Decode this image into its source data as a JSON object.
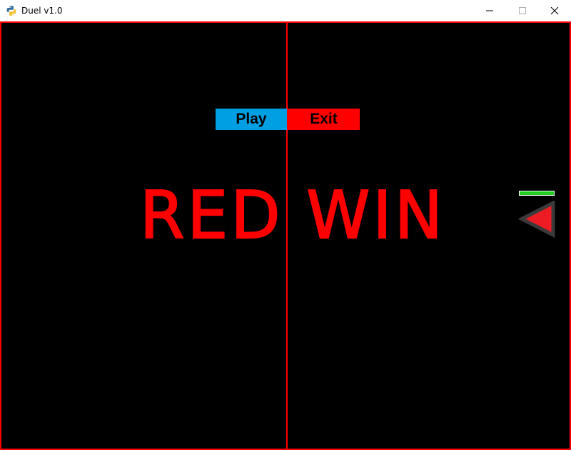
{
  "window": {
    "title": "Duel v1.0",
    "icon": "python-icon",
    "controls": [
      "minimize-icon",
      "maximize-icon",
      "close-icon"
    ]
  },
  "game": {
    "background_color": "#000000",
    "border_color": "#ff0000",
    "divider_color": "#ff0000",
    "menu": {
      "play_label": "Play",
      "play_color": "#009ee3",
      "exit_label": "Exit",
      "exit_color": "#ff0000"
    },
    "result_text": "RED WIN",
    "result_color": "#ff0000",
    "red_player": {
      "icon": "red-triangle-ship",
      "fill_color": "#ed1c24",
      "outline_color": "#3a3a3a",
      "facing": "left",
      "health_fraction": 1.0,
      "health_color": "#22cc22"
    }
  }
}
